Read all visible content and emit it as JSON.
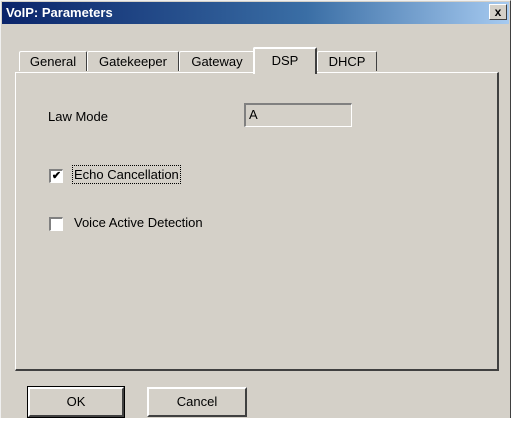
{
  "window": {
    "title": "VoIP: Parameters",
    "close_glyph": "x"
  },
  "tabs": [
    {
      "label": "General",
      "active": false
    },
    {
      "label": "Gatekeeper",
      "active": false
    },
    {
      "label": "Gateway",
      "active": false
    },
    {
      "label": "DSP",
      "active": true
    },
    {
      "label": "DHCP",
      "active": false
    }
  ],
  "dsp": {
    "law_mode_label": "Law Mode",
    "law_mode_value": "A",
    "echo_cancellation_label": "Echo Cancellation",
    "echo_cancellation_checked": true,
    "check_glyph": "✔",
    "voice_active_detection_label": "Voice Active Detection",
    "voice_active_detection_checked": false
  },
  "buttons": {
    "ok_label": "OK",
    "cancel_label": "Cancel"
  }
}
